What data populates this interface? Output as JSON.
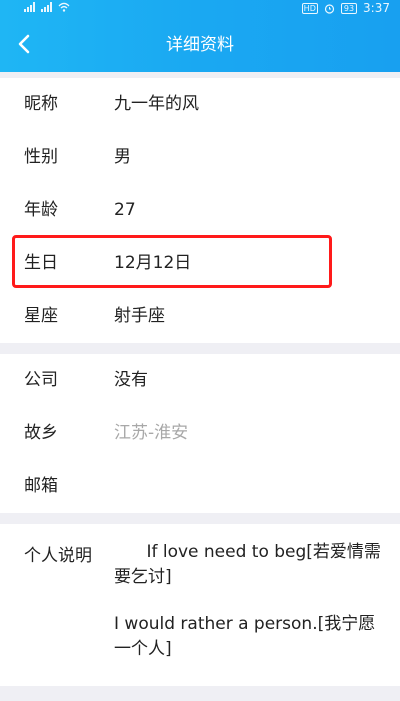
{
  "status_bar": {
    "battery": "93",
    "time": "3:37",
    "hd": "HD"
  },
  "header": {
    "title": "详细资料",
    "back_icon": "chevron-left-icon"
  },
  "basic_info": [
    {
      "label": "昵称",
      "value": "九一年的风"
    },
    {
      "label": "性别",
      "value": "男"
    },
    {
      "label": "年龄",
      "value": "27"
    },
    {
      "label": "生日",
      "value": "12月12日"
    },
    {
      "label": "星座",
      "value": "射手座"
    }
  ],
  "extra_info": [
    {
      "label": "公司",
      "value": "没有"
    },
    {
      "label": "故乡",
      "value": "江苏-淮安"
    },
    {
      "label": "邮箱",
      "value": ""
    }
  ],
  "about": {
    "label": "个人说明",
    "paragraphs": [
      "      If love need to beg[若爱情需要乞讨]",
      "I would rather a person.[我宁愿一个人]"
    ]
  },
  "colors": {
    "header": "#1aa8f2",
    "highlight": "#ff1a1a",
    "placeholder_text": "#a8a8a8"
  }
}
